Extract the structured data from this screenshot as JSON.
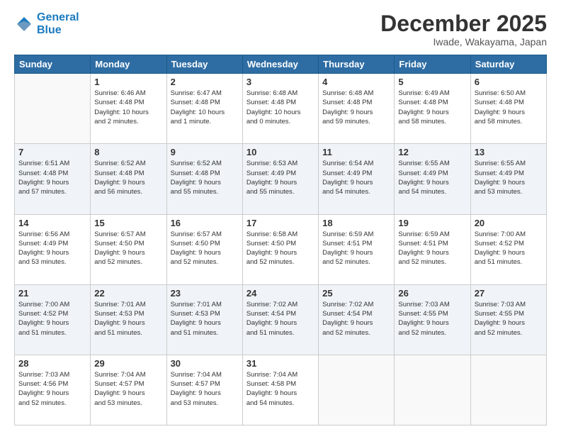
{
  "logo": {
    "line1": "General",
    "line2": "Blue"
  },
  "title": "December 2025",
  "subtitle": "Iwade, Wakayama, Japan",
  "headers": [
    "Sunday",
    "Monday",
    "Tuesday",
    "Wednesday",
    "Thursday",
    "Friday",
    "Saturday"
  ],
  "weeks": [
    [
      {
        "day": "",
        "info": ""
      },
      {
        "day": "1",
        "info": "Sunrise: 6:46 AM\nSunset: 4:48 PM\nDaylight: 10 hours\nand 2 minutes."
      },
      {
        "day": "2",
        "info": "Sunrise: 6:47 AM\nSunset: 4:48 PM\nDaylight: 10 hours\nand 1 minute."
      },
      {
        "day": "3",
        "info": "Sunrise: 6:48 AM\nSunset: 4:48 PM\nDaylight: 10 hours\nand 0 minutes."
      },
      {
        "day": "4",
        "info": "Sunrise: 6:48 AM\nSunset: 4:48 PM\nDaylight: 9 hours\nand 59 minutes."
      },
      {
        "day": "5",
        "info": "Sunrise: 6:49 AM\nSunset: 4:48 PM\nDaylight: 9 hours\nand 58 minutes."
      },
      {
        "day": "6",
        "info": "Sunrise: 6:50 AM\nSunset: 4:48 PM\nDaylight: 9 hours\nand 58 minutes."
      }
    ],
    [
      {
        "day": "7",
        "info": "Sunrise: 6:51 AM\nSunset: 4:48 PM\nDaylight: 9 hours\nand 57 minutes."
      },
      {
        "day": "8",
        "info": "Sunrise: 6:52 AM\nSunset: 4:48 PM\nDaylight: 9 hours\nand 56 minutes."
      },
      {
        "day": "9",
        "info": "Sunrise: 6:52 AM\nSunset: 4:48 PM\nDaylight: 9 hours\nand 55 minutes."
      },
      {
        "day": "10",
        "info": "Sunrise: 6:53 AM\nSunset: 4:49 PM\nDaylight: 9 hours\nand 55 minutes."
      },
      {
        "day": "11",
        "info": "Sunrise: 6:54 AM\nSunset: 4:49 PM\nDaylight: 9 hours\nand 54 minutes."
      },
      {
        "day": "12",
        "info": "Sunrise: 6:55 AM\nSunset: 4:49 PM\nDaylight: 9 hours\nand 54 minutes."
      },
      {
        "day": "13",
        "info": "Sunrise: 6:55 AM\nSunset: 4:49 PM\nDaylight: 9 hours\nand 53 minutes."
      }
    ],
    [
      {
        "day": "14",
        "info": "Sunrise: 6:56 AM\nSunset: 4:49 PM\nDaylight: 9 hours\nand 53 minutes."
      },
      {
        "day": "15",
        "info": "Sunrise: 6:57 AM\nSunset: 4:50 PM\nDaylight: 9 hours\nand 52 minutes."
      },
      {
        "day": "16",
        "info": "Sunrise: 6:57 AM\nSunset: 4:50 PM\nDaylight: 9 hours\nand 52 minutes."
      },
      {
        "day": "17",
        "info": "Sunrise: 6:58 AM\nSunset: 4:50 PM\nDaylight: 9 hours\nand 52 minutes."
      },
      {
        "day": "18",
        "info": "Sunrise: 6:59 AM\nSunset: 4:51 PM\nDaylight: 9 hours\nand 52 minutes."
      },
      {
        "day": "19",
        "info": "Sunrise: 6:59 AM\nSunset: 4:51 PM\nDaylight: 9 hours\nand 52 minutes."
      },
      {
        "day": "20",
        "info": "Sunrise: 7:00 AM\nSunset: 4:52 PM\nDaylight: 9 hours\nand 51 minutes."
      }
    ],
    [
      {
        "day": "21",
        "info": "Sunrise: 7:00 AM\nSunset: 4:52 PM\nDaylight: 9 hours\nand 51 minutes."
      },
      {
        "day": "22",
        "info": "Sunrise: 7:01 AM\nSunset: 4:53 PM\nDaylight: 9 hours\nand 51 minutes."
      },
      {
        "day": "23",
        "info": "Sunrise: 7:01 AM\nSunset: 4:53 PM\nDaylight: 9 hours\nand 51 minutes."
      },
      {
        "day": "24",
        "info": "Sunrise: 7:02 AM\nSunset: 4:54 PM\nDaylight: 9 hours\nand 51 minutes."
      },
      {
        "day": "25",
        "info": "Sunrise: 7:02 AM\nSunset: 4:54 PM\nDaylight: 9 hours\nand 52 minutes."
      },
      {
        "day": "26",
        "info": "Sunrise: 7:03 AM\nSunset: 4:55 PM\nDaylight: 9 hours\nand 52 minutes."
      },
      {
        "day": "27",
        "info": "Sunrise: 7:03 AM\nSunset: 4:55 PM\nDaylight: 9 hours\nand 52 minutes."
      }
    ],
    [
      {
        "day": "28",
        "info": "Sunrise: 7:03 AM\nSunset: 4:56 PM\nDaylight: 9 hours\nand 52 minutes."
      },
      {
        "day": "29",
        "info": "Sunrise: 7:04 AM\nSunset: 4:57 PM\nDaylight: 9 hours\nand 53 minutes."
      },
      {
        "day": "30",
        "info": "Sunrise: 7:04 AM\nSunset: 4:57 PM\nDaylight: 9 hours\nand 53 minutes."
      },
      {
        "day": "31",
        "info": "Sunrise: 7:04 AM\nSunset: 4:58 PM\nDaylight: 9 hours\nand 54 minutes."
      },
      {
        "day": "",
        "info": ""
      },
      {
        "day": "",
        "info": ""
      },
      {
        "day": "",
        "info": ""
      }
    ]
  ]
}
